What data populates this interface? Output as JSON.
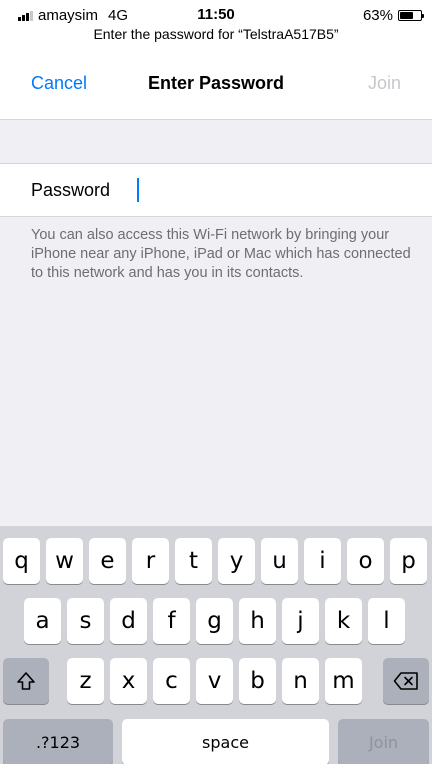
{
  "status_bar": {
    "carrier": "amaysim",
    "network": "4G",
    "time": "11:50",
    "battery_percent": "63%",
    "battery_level": 0.63
  },
  "prompt": "Enter the password for “TelstraA517B5”",
  "nav": {
    "cancel_label": "Cancel",
    "title": "Enter Password",
    "join_label": "Join"
  },
  "form": {
    "password_label": "Password",
    "password_value": ""
  },
  "footer_note": "You can also access this Wi-Fi network by bringing your iPhone near any iPhone, iPad or Mac which has connected to this network and has you in its contacts.",
  "keyboard": {
    "row1": [
      "q",
      "w",
      "e",
      "r",
      "t",
      "y",
      "u",
      "i",
      "o",
      "p"
    ],
    "row2": [
      "a",
      "s",
      "d",
      "f",
      "g",
      "h",
      "j",
      "k",
      "l"
    ],
    "row3": [
      "z",
      "x",
      "c",
      "v",
      "b",
      "n",
      "m"
    ],
    "numbers_label": ".?123",
    "space_label": "space",
    "join_label": "Join",
    "shift_icon": "shift-icon",
    "delete_icon": "delete-backspace-icon"
  },
  "colors": {
    "accent": "#007aff",
    "disabled": "#c7c7cc",
    "background": "#efeff4",
    "keyboard_bg": "#d1d3d9"
  }
}
